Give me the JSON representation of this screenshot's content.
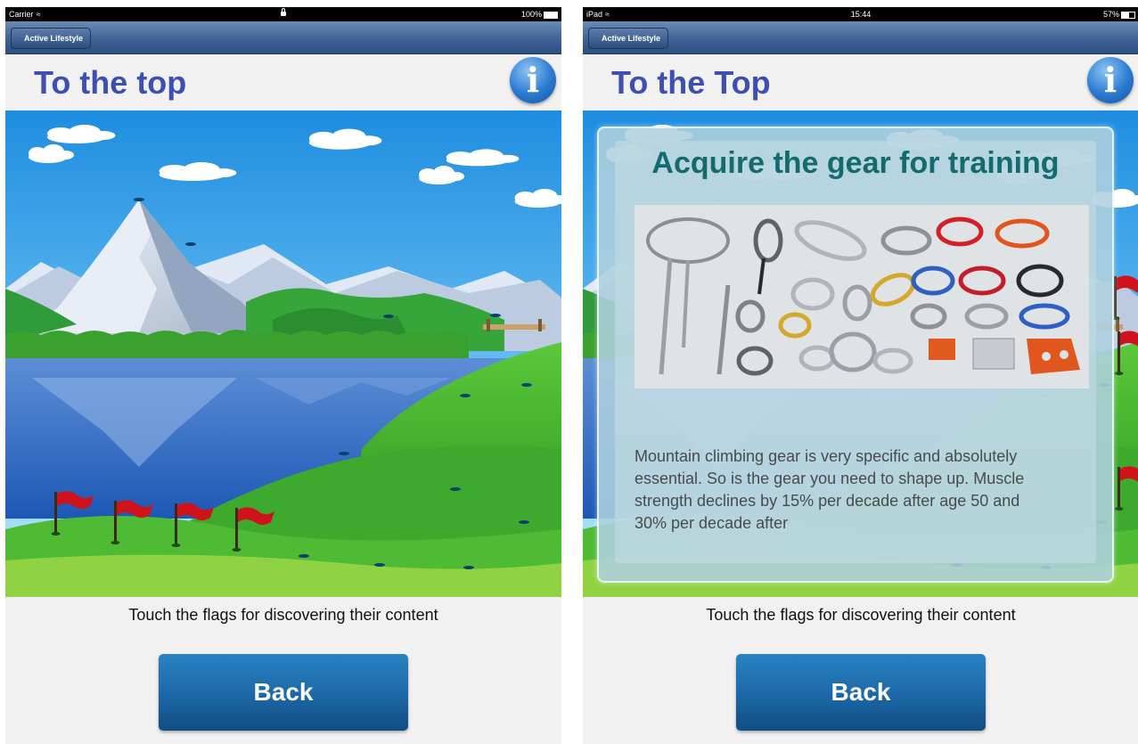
{
  "screens": [
    {
      "status": {
        "left": "Carrier",
        "center": "",
        "right": "100%",
        "battery": 1.0,
        "locked": true
      },
      "nav_back_label": "Active Lifestyle",
      "title": "To the top",
      "info_label": "i",
      "flags": [
        "flag-1",
        "flag-2",
        "flag-3",
        "flag-4"
      ],
      "instruction": "Touch the flags for discovering their content",
      "back_label": "Back"
    },
    {
      "status": {
        "left": "iPad",
        "center": "15:44",
        "right": "57%",
        "battery": 0.57
      },
      "nav_back_label": "Active Lifestyle",
      "title": "To the Top",
      "info_label": "i",
      "popup": {
        "title": "Acquire the gear for training",
        "text": "Mountain climbing gear is very specific and absolutely essential. So is the gear you need to shape up. Muscle strength declines by 15% per decade after age 50 and 30% per decade after"
      },
      "instruction": "Touch the flags for discovering their content",
      "back_label": "Back"
    }
  ],
  "colors": {
    "title": "#3d4fb3",
    "nav_bar": "#3f6397",
    "back_button": "#1d6aa9",
    "popup_title": "#136b6e",
    "flag": "#d0121c"
  }
}
